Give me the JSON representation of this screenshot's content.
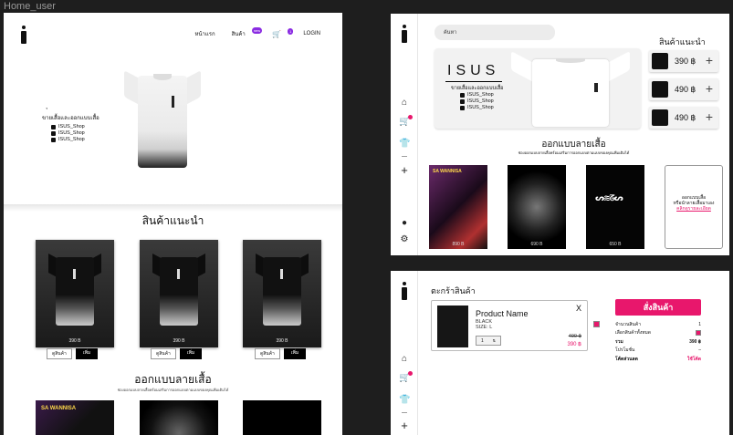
{
  "frame_label": "Home_user",
  "home": {
    "nav": {
      "home": "หน้าแรก",
      "products": "สินค้า",
      "products_badge": "new",
      "cart_badge": "1",
      "login": "LOGIN"
    },
    "hero_tagline": "ขายเสื้อและออกแบบเสื้อ",
    "social": [
      "ISUS_Shop",
      "ISUS_Shop",
      "ISUS_Shop"
    ],
    "recommended_title": "สินค้าแนะนำ",
    "products": [
      {
        "price": "390 B",
        "detail_label": "ดูสินค้า",
        "add_label": "เพิ่ม"
      },
      {
        "price": "390 B",
        "detail_label": "ดูสินค้า",
        "add_label": "เพิ่ม"
      },
      {
        "price": "390 B",
        "detail_label": "ดูสินค้า",
        "add_label": "เพิ่ม"
      }
    ],
    "design_title": "ออกแบบลายเสื้อ",
    "design_sub": "ช่องออกแบบลายเสื้อพร้อมเสริมการออกแบบตามแบบของคุณเพิ่มเติมได้",
    "design_card_header": "SA WANNISA"
  },
  "dashboard": {
    "search_placeholder": "ค้นหา",
    "brand": "ISUS",
    "tagline": "ขายเสื้อและออกแบบเสื้อ",
    "social": [
      "ISUS_Shop",
      "ISUS_Shop",
      "ISUS_Shop"
    ],
    "recommended_title": "สินค้าแนะนำ",
    "rec_items": [
      {
        "price": "390 ฿"
      },
      {
        "price": "490 ฿"
      },
      {
        "price": "490 ฿"
      }
    ],
    "design_title": "ออกแบบลายเสื้อ",
    "design_sub": "ช่องออกแบบลายเสื้อพร้อมเสริมการออกแบบตามแบบของคุณเพิ่มเติมได้",
    "designs": [
      {
        "header": "SA WANNISA",
        "price": "890 B"
      },
      {
        "price": "690 B"
      },
      {
        "price": "650 B"
      }
    ],
    "custom_card": {
      "line1": "ออกแบบเสื้อ",
      "line2": "หรือนำลายเสื้อมาเอง",
      "link": "คลิกดูรายละเอียด"
    }
  },
  "cart": {
    "title": "ตะกร้าสินค้า",
    "item": {
      "name": "Product Name",
      "color": "BLACK",
      "size": "SIZE: L",
      "qty": "1",
      "old_price": "490 ฿",
      "new_price": "390 ฿",
      "remove": "X"
    },
    "order_button": "สั่งสินค้า",
    "summary": [
      {
        "label": "จำนวนสินค้า",
        "value": "1"
      },
      {
        "label": "เลือกสินค้าทั้งหมด",
        "value": ""
      },
      {
        "label": "รวม",
        "value": "390 ฿"
      },
      {
        "label": "โปรโมชั่น",
        "value": "–"
      },
      {
        "label": "โค้ดส่วนลด",
        "value": "ใช้โค้ด"
      }
    ]
  },
  "colors": {
    "accent": "#e8176c",
    "badge": "#8a2be2",
    "canvas": "#1e1e1e"
  }
}
